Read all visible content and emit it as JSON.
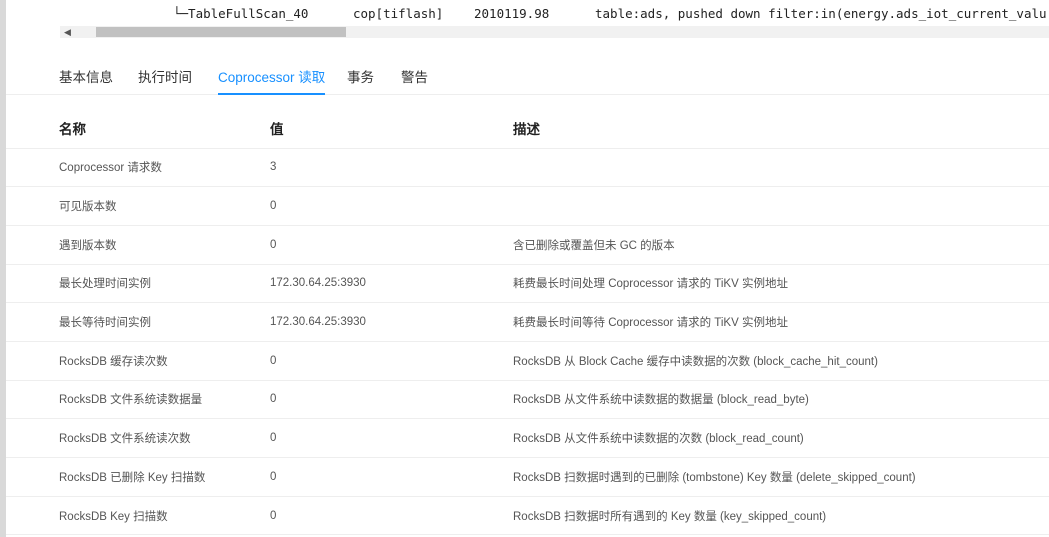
{
  "plan_row": {
    "operator": "└─TableFullScan_40",
    "task": "cop[tiflash]",
    "est_rows": "2010119.98",
    "info": "table:ads, pushed down filter:in(energy.ads_iot_current_valu"
  },
  "tabs": [
    {
      "label": "基本信息"
    },
    {
      "label": "执行时间"
    },
    {
      "label": "Coprocessor 读取",
      "active": true
    },
    {
      "label": "事务"
    },
    {
      "label": "警告"
    }
  ],
  "table": {
    "headers": [
      "名称",
      "值",
      "描述"
    ],
    "rows": [
      [
        "Coprocessor 请求数",
        "3",
        ""
      ],
      [
        "可见版本数",
        "0",
        ""
      ],
      [
        "遇到版本数",
        "0",
        "含已删除或覆盖但未 GC 的版本"
      ],
      [
        "最长处理时间实例",
        "172.30.64.25:3930",
        "耗费最长时间处理 Coprocessor 请求的 TiKV 实例地址"
      ],
      [
        "最长等待时间实例",
        "172.30.64.25:3930",
        "耗费最长时间等待 Coprocessor 请求的 TiKV 实例地址"
      ],
      [
        "RocksDB 缓存读次数",
        "0",
        "RocksDB 从 Block Cache 缓存中读数据的次数 (block_cache_hit_count)"
      ],
      [
        "RocksDB 文件系统读数据量",
        "0",
        "RocksDB 从文件系统中读数据的数据量 (block_read_byte)"
      ],
      [
        "RocksDB 文件系统读次数",
        "0",
        "RocksDB 从文件系统中读数据的次数 (block_read_count)"
      ],
      [
        "RocksDB 已删除 Key 扫描数",
        "0",
        "RocksDB 扫数据时遇到的已删除 (tombstone) Key 数量 (delete_skipped_count)"
      ],
      [
        "RocksDB Key 扫描数",
        "0",
        "RocksDB 扫数据时所有遇到的 Key 数量 (key_skipped_count)"
      ]
    ]
  },
  "colors": {
    "accent": "#1890ff"
  }
}
